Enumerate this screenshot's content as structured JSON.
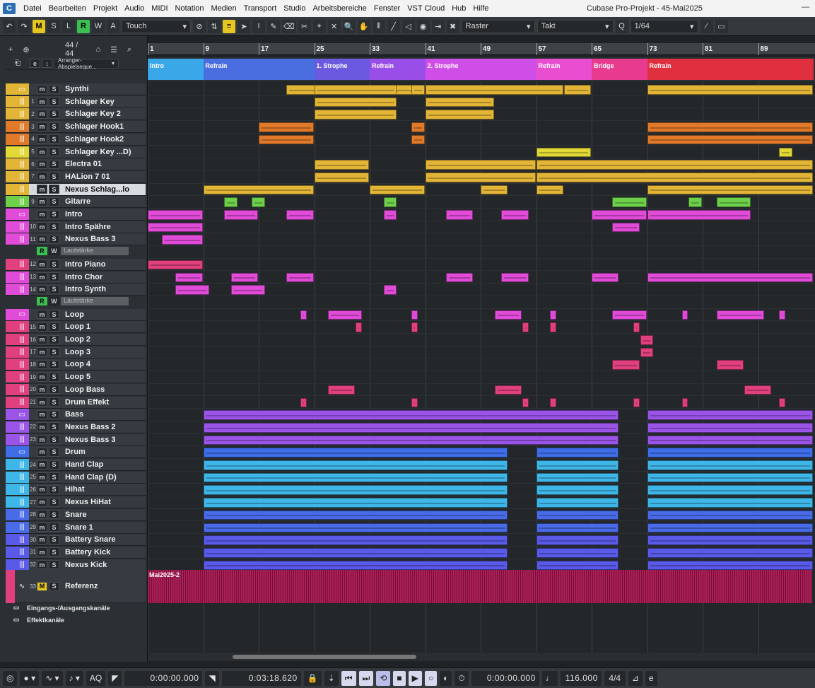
{
  "menubar": {
    "logo": "cubase-logo",
    "items": [
      "Datei",
      "Bearbeiten",
      "Projekt",
      "Audio",
      "MIDI",
      "Notation",
      "Medien",
      "Transport",
      "Studio",
      "Arbeitsbereiche",
      "Fenster",
      "VST Cloud",
      "Hub",
      "Hilfe"
    ],
    "title": "Cubase Pro-Projekt - 45-Mai2025"
  },
  "toolbar": {
    "m": "M",
    "s": "S",
    "l": "L",
    "r": "R",
    "w": "W",
    "a": "A",
    "automation_mode": "Touch",
    "snap_type": "Raster",
    "grid_type": "Takt",
    "quantize": "1/64"
  },
  "trackhead": {
    "count": "44 / 44",
    "arranger_name": "Arranger-Abspielseque..."
  },
  "colors": {
    "synth": "#e2b536",
    "orange": "#e07a2a",
    "green": "#6ed04a",
    "pink": "#e04bd8",
    "loop": "#e0407e",
    "bass": "#9a55e8",
    "drum": "#3fb6e8",
    "snare": "#4a6be8",
    "ref": "#b01a55",
    "ruler": "#3d4347"
  },
  "ruler": {
    "bars": [
      "1",
      "9",
      "17",
      "25",
      "33",
      "41",
      "49",
      "57",
      "65",
      "73",
      "81",
      "89"
    ]
  },
  "arranger": [
    {
      "label": "Intro",
      "bar": 1,
      "end": 9,
      "color": "#3aa8e8"
    },
    {
      "label": "Refrain",
      "bar": 9,
      "end": 25,
      "color": "#4a6ee0"
    },
    {
      "label": "1. Strophe",
      "bar": 25,
      "end": 33,
      "color": "#6a5ae0"
    },
    {
      "label": "Refrain",
      "bar": 33,
      "end": 41,
      "color": "#9a4ee8"
    },
    {
      "label": "2. Strophe",
      "bar": 41,
      "end": 57,
      "color": "#d04ee8"
    },
    {
      "label": "Refrain",
      "bar": 57,
      "end": 65,
      "color": "#e84ecf"
    },
    {
      "label": "Bridge",
      "bar": 65,
      "end": 73,
      "color": "#e83a8f"
    },
    {
      "label": "Refrain",
      "bar": 73,
      "end": 97,
      "color": "#e03040"
    }
  ],
  "tracks": [
    {
      "name": "Synthi",
      "folder": true,
      "color": "#e2b536",
      "num": "",
      "icon": "folder-icon"
    },
    {
      "name": "Schlager Key",
      "num": "1",
      "color": "#e2b536",
      "icon": "instrument-icon"
    },
    {
      "name": "Schlager Key 2",
      "num": "2",
      "color": "#e2b536",
      "icon": "instrument-icon"
    },
    {
      "name": "Schlager Hook1",
      "num": "3",
      "color": "#e07a2a",
      "icon": "instrument-icon"
    },
    {
      "name": "Schlager Hook2",
      "num": "4",
      "color": "#e07a2a",
      "icon": "instrument-icon"
    },
    {
      "name": "Schlager Key ...D)",
      "num": "5",
      "color": "#e2d836",
      "icon": "instrument-icon"
    },
    {
      "name": "Electra 01",
      "num": "6",
      "color": "#e2b536",
      "icon": "instrument-icon"
    },
    {
      "name": "HALion 7 01",
      "num": "7",
      "color": "#e2b536",
      "icon": "instrument-icon"
    },
    {
      "name": "Nexus Schlag...lo",
      "num": "8",
      "color": "#e2b536",
      "icon": "instrument-icon",
      "selected": true
    },
    {
      "name": "Gitarre",
      "num": "9",
      "color": "#6ed04a",
      "icon": "instrument-icon"
    },
    {
      "name": "Intro",
      "folder": true,
      "color": "#e04bd8",
      "num": "",
      "icon": "folder-icon"
    },
    {
      "name": "Intro Spähre",
      "num": "10",
      "color": "#e04bd8",
      "icon": "instrument-icon"
    },
    {
      "name": "Nexus Bass 3",
      "num": "11",
      "color": "#e04bd8",
      "icon": "instrument-icon"
    },
    {
      "name": "Lautstärke",
      "auto": true
    },
    {
      "name": "Intro Piano",
      "num": "12",
      "color": "#e0407e",
      "icon": "instrument-icon"
    },
    {
      "name": "Intro Chor",
      "num": "13",
      "color": "#e04bd8",
      "icon": "instrument-icon"
    },
    {
      "name": "Intro Synth",
      "num": "14",
      "color": "#e04bd8",
      "icon": "instrument-icon"
    },
    {
      "name": "Lautstärke",
      "auto": true
    },
    {
      "name": "Loop",
      "folder": true,
      "color": "#e04bd8",
      "num": "",
      "icon": "folder-icon"
    },
    {
      "name": "Loop 1",
      "num": "15",
      "color": "#e0407e",
      "icon": "instrument-icon"
    },
    {
      "name": "Loop 2",
      "num": "16",
      "color": "#e0407e",
      "icon": "instrument-icon"
    },
    {
      "name": "Loop 3",
      "num": "17",
      "color": "#e0407e",
      "icon": "instrument-icon"
    },
    {
      "name": "Loop 4",
      "num": "18",
      "color": "#e0407e",
      "icon": "instrument-icon"
    },
    {
      "name": "Loop 5",
      "num": "19",
      "color": "#e0407e",
      "icon": "instrument-icon"
    },
    {
      "name": "Loop Bass",
      "num": "20",
      "color": "#e0407e",
      "icon": "instrument-icon"
    },
    {
      "name": "Drum Effekt",
      "num": "21",
      "color": "#e0407e",
      "icon": "instrument-icon"
    },
    {
      "name": "Bass",
      "folder": true,
      "color": "#9a55e8",
      "num": "",
      "icon": "folder-icon"
    },
    {
      "name": "Nexus Bass 2",
      "num": "22",
      "color": "#9a55e8",
      "icon": "instrument-icon"
    },
    {
      "name": "Nexus Bass 3",
      "num": "23",
      "color": "#9a55e8",
      "icon": "instrument-icon"
    },
    {
      "name": "Drum",
      "folder": true,
      "color": "#3f6ee8",
      "num": "",
      "icon": "folder-icon"
    },
    {
      "name": "Hand Clap",
      "num": "24",
      "color": "#3fb6e8",
      "icon": "instrument-icon"
    },
    {
      "name": "Hand Clap (D)",
      "num": "25",
      "color": "#3fb6e8",
      "icon": "instrument-icon"
    },
    {
      "name": "Hihat",
      "num": "26",
      "color": "#3fb6e8",
      "icon": "instrument-icon"
    },
    {
      "name": "Nexus HiHat",
      "num": "27",
      "color": "#3fb6e8",
      "icon": "instrument-icon"
    },
    {
      "name": "Snare",
      "num": "28",
      "color": "#4a6be8",
      "icon": "instrument-icon"
    },
    {
      "name": "Snare 1",
      "num": "29",
      "color": "#4a6be8",
      "icon": "instrument-icon"
    },
    {
      "name": "Battery Snare",
      "num": "30",
      "color": "#5a5ae8",
      "icon": "instrument-icon"
    },
    {
      "name": "Battery Kick",
      "num": "31",
      "color": "#5a5ae8",
      "icon": "instrument-icon"
    },
    {
      "name": "Nexus Kick",
      "num": "32",
      "color": "#5a5ae8",
      "icon": "instrument-icon"
    }
  ],
  "reference_track": {
    "name": "Referenz",
    "num": "33",
    "clip": "Mai2025-2"
  },
  "folders_bottom": [
    "Eingangs-/Ausgangskanäle",
    "Effektkanäle"
  ],
  "transport": {
    "left_locator": "0:00:00.000",
    "right_locator": "0:03:18.620",
    "position": "0:00:00.000",
    "tempo": "116.000",
    "signature": "4/4",
    "aq": "AQ"
  }
}
